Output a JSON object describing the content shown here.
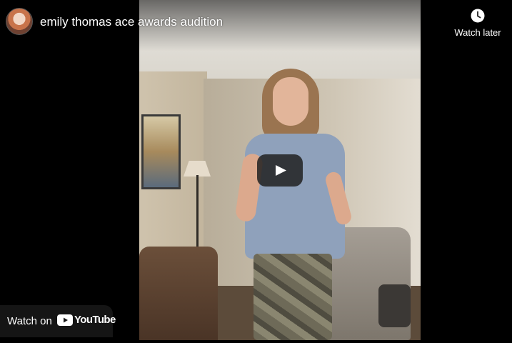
{
  "video": {
    "title": "emily thomas ace awards audition"
  },
  "watch_later": {
    "label": "Watch later",
    "icon": "clock-icon"
  },
  "play_button": {
    "icon": "play-icon",
    "color": "#212121"
  },
  "watch_on": {
    "label": "Watch on",
    "brand": "YouTube",
    "brand_color": "#ffffff"
  },
  "channel": {
    "avatar": "channel-avatar"
  }
}
